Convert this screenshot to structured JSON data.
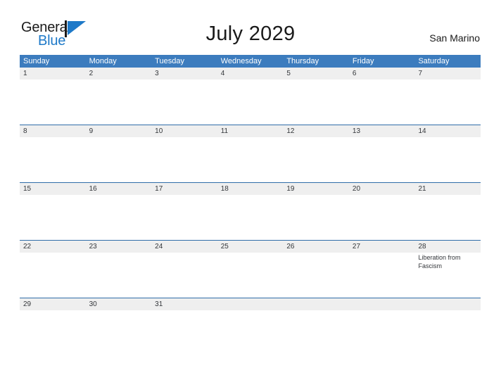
{
  "brand": {
    "name_part1": "General",
    "name_part2": "Blue",
    "flag_icon": "blue-triangle-flag-icon",
    "color_primary": "#1e79c8"
  },
  "header": {
    "title": "July 2029",
    "region": "San Marino"
  },
  "theme": {
    "header_blue": "#3c7cbe",
    "row_rule_blue": "#2f6ca8",
    "number_band_gray": "#efefef",
    "text_dark": "#33363a"
  },
  "calendar": {
    "weekdays": [
      "Sunday",
      "Monday",
      "Tuesday",
      "Wednesday",
      "Thursday",
      "Friday",
      "Saturday"
    ],
    "weeks": [
      {
        "days": [
          {
            "num": "1",
            "events": []
          },
          {
            "num": "2",
            "events": []
          },
          {
            "num": "3",
            "events": []
          },
          {
            "num": "4",
            "events": []
          },
          {
            "num": "5",
            "events": []
          },
          {
            "num": "6",
            "events": []
          },
          {
            "num": "7",
            "events": []
          }
        ]
      },
      {
        "days": [
          {
            "num": "8",
            "events": []
          },
          {
            "num": "9",
            "events": []
          },
          {
            "num": "10",
            "events": []
          },
          {
            "num": "11",
            "events": []
          },
          {
            "num": "12",
            "events": []
          },
          {
            "num": "13",
            "events": []
          },
          {
            "num": "14",
            "events": []
          }
        ]
      },
      {
        "days": [
          {
            "num": "15",
            "events": []
          },
          {
            "num": "16",
            "events": []
          },
          {
            "num": "17",
            "events": []
          },
          {
            "num": "18",
            "events": []
          },
          {
            "num": "19",
            "events": []
          },
          {
            "num": "20",
            "events": []
          },
          {
            "num": "21",
            "events": []
          }
        ]
      },
      {
        "days": [
          {
            "num": "22",
            "events": []
          },
          {
            "num": "23",
            "events": []
          },
          {
            "num": "24",
            "events": []
          },
          {
            "num": "25",
            "events": []
          },
          {
            "num": "26",
            "events": []
          },
          {
            "num": "27",
            "events": []
          },
          {
            "num": "28",
            "events": [
              "Liberation from Fascism"
            ]
          }
        ]
      },
      {
        "days": [
          {
            "num": "29",
            "events": []
          },
          {
            "num": "30",
            "events": []
          },
          {
            "num": "31",
            "events": []
          },
          {
            "num": "",
            "events": []
          },
          {
            "num": "",
            "events": []
          },
          {
            "num": "",
            "events": []
          },
          {
            "num": "",
            "events": []
          }
        ]
      }
    ]
  }
}
